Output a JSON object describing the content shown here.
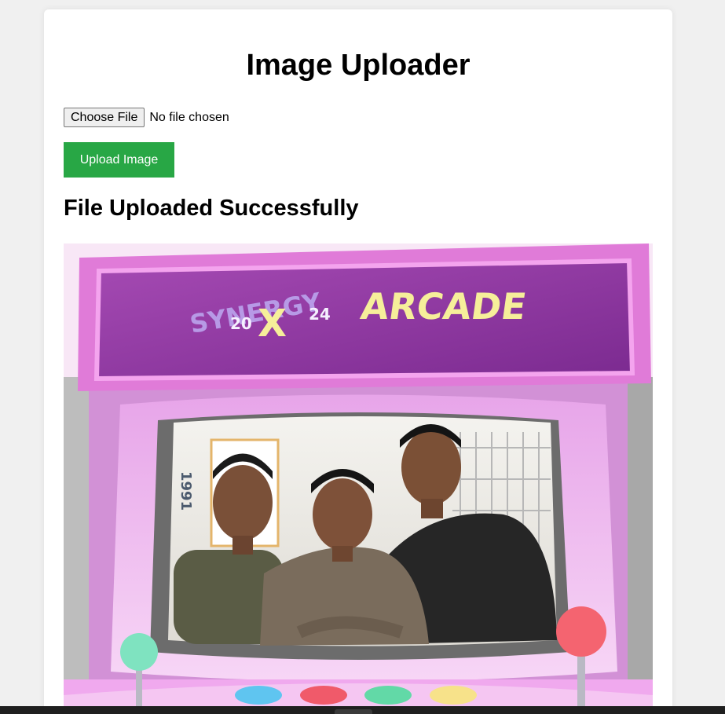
{
  "page": {
    "title": "Image Uploader",
    "file_input": {
      "button_label": "Choose File",
      "status_text": "No file chosen"
    },
    "upload_button_label": "Upload Image",
    "result_heading": "File Uploaded Successfully"
  },
  "uploaded_image": {
    "banner_text_left": "SYNERGY",
    "banner_year_left": "20",
    "banner_year_right": "24",
    "banner_x": "X",
    "banner_text_right": "ARCADE",
    "poster_text": "1991"
  },
  "colors": {
    "upload_button": "#28a745",
    "page_background": "#f0f0f0",
    "card_background": "#ffffff"
  }
}
